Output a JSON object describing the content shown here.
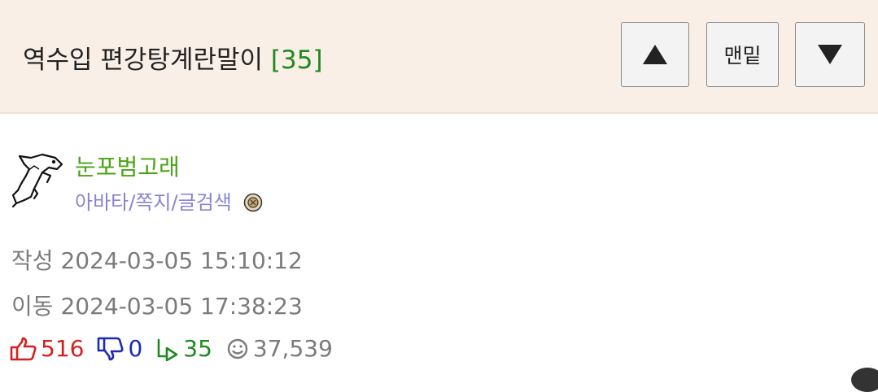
{
  "header": {
    "title": "역수입 편강탕계란말이",
    "comment_count": "[35]",
    "btn_bottom_label": "맨밑"
  },
  "author": {
    "nickname": "눈포범고래",
    "links": {
      "avatar": "아바타",
      "message": "쪽지",
      "search": "글검색",
      "sep1": "/",
      "sep2": "/"
    }
  },
  "meta": {
    "written_label": "작성",
    "written_value": "2024-03-05 15:10:12",
    "moved_label": "이동",
    "moved_value": "2024-03-05 17:38:23"
  },
  "stats": {
    "likes": "516",
    "dislikes": "0",
    "replies": "35",
    "views": "37,539"
  },
  "colors": {
    "header_bg": "#f9efe6",
    "nickname": "#4aa312",
    "links": "#8a84cf",
    "like": "#d62020",
    "dislike": "#1b2bb5",
    "reply": "#1e8a1e"
  }
}
